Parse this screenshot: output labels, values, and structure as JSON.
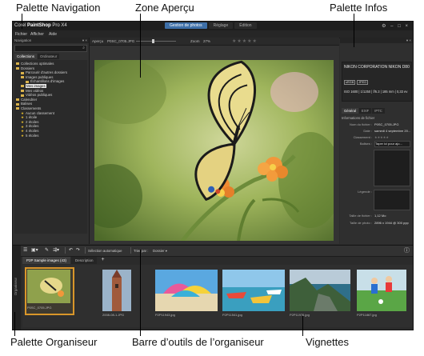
{
  "callouts": {
    "palette_navigation": "Palette Navigation",
    "zone_apercu": "Zone Aperçu",
    "palette_infos": "Palette Infos",
    "palette_organiseur": "Palette Organiseur",
    "barre_outils": "Barre d’outils de l’organiseur",
    "vignettes": "Vignettes"
  },
  "app": {
    "title_prefix": "Corel",
    "title_bold": "PaintShop",
    "title_suffix": "Pro X4",
    "modes": [
      "Gestion de photos",
      "Réglage",
      "Édition"
    ],
    "menu": [
      "Fichier",
      "Afficher",
      "Aide"
    ],
    "window_controls": "⚙ – □ ×"
  },
  "navigation": {
    "title": "Navigation",
    "tabs": [
      "Collections",
      "Ordinateur"
    ],
    "tree": [
      {
        "label": "Collections optimales",
        "level": 0,
        "type": "folder"
      },
      {
        "label": "Dossiers",
        "level": 0,
        "type": "folder"
      },
      {
        "label": "Parcourir d'autres dossiers",
        "level": 1,
        "type": "folder"
      },
      {
        "label": "Images publiques",
        "level": 1,
        "type": "folder"
      },
      {
        "label": "Échantillons d'images",
        "level": 2,
        "type": "folder"
      },
      {
        "label": "Mes images",
        "level": 1,
        "type": "folder",
        "selected": true
      },
      {
        "label": "Mes vidéos",
        "level": 1,
        "type": "folder"
      },
      {
        "label": "Vidéos publiques",
        "level": 1,
        "type": "folder"
      },
      {
        "label": "Calendrier",
        "level": 0,
        "type": "folder"
      },
      {
        "label": "Balises",
        "level": 0,
        "type": "folder"
      },
      {
        "label": "Classements",
        "level": 0,
        "type": "folder"
      },
      {
        "label": "Aucun classement",
        "level": 1,
        "type": "star"
      },
      {
        "label": "1 étoile",
        "level": 1,
        "type": "star"
      },
      {
        "label": "2 étoiles",
        "level": 1,
        "type": "star"
      },
      {
        "label": "3 étoiles",
        "level": 1,
        "type": "star"
      },
      {
        "label": "4 étoiles",
        "level": 1,
        "type": "star"
      },
      {
        "label": "5 étoiles",
        "level": 1,
        "type": "star"
      }
    ]
  },
  "preview": {
    "label": "Aperçu",
    "filename": "P0SC_0705.JPG",
    "zoom_label": "Zoom",
    "zoom_value": "27%",
    "rating": "★★★★★"
  },
  "info": {
    "camera_model": "NIKON CORPORATION NIKON D80",
    "badges": [
      "sRGB",
      "JPEG"
    ],
    "iso": "ISO 1600",
    "shutter": "1/1250",
    "aperture": "f/5.3",
    "focal": "185 mm",
    "ev": "0,33 ev",
    "tabs": [
      "Général",
      "EXIF",
      "IPTC"
    ],
    "section": "Informations de fichier",
    "fields": [
      {
        "k": "Nom du fichier :",
        "v": "P0SC_0705.JPG"
      },
      {
        "k": "Date :",
        "v": "samedi 4 septembre 20..."
      },
      {
        "k": "Classement :",
        "v": "★★★★★"
      },
      {
        "k": "Balises :",
        "v": "Taper ici pour ajo..."
      }
    ],
    "caption_label": "Légende :",
    "size_label": "Taille de fichier :",
    "size_value": "1,12 Mo",
    "dims_label": "Taille de photo :",
    "dims_value": "2896 x 1944 @ 300 ppp"
  },
  "organizer": {
    "side_label": "Organiseur",
    "toolbar": {
      "auto_select": "Sélection automatique",
      "sort_label": "Trier par :",
      "sort_value": "Dossier"
    },
    "tabs": [
      "P2P Sample images (43)",
      "Description"
    ],
    "add_tab": "+",
    "thumbnails": [
      {
        "caption": "P0SC_0705.JPG",
        "selected": true
      },
      {
        "caption": "2008-08-1.JPG"
      },
      {
        "caption": "P2P11943.jpg"
      },
      {
        "caption": "P2P11541.jpg"
      },
      {
        "caption": "P2P11976.jpg"
      },
      {
        "caption": "P2P11867.jpg"
      }
    ]
  },
  "colors": {
    "accent": "#3d6fa8",
    "selection": "#d9962a",
    "background": "#2c2c2c"
  }
}
